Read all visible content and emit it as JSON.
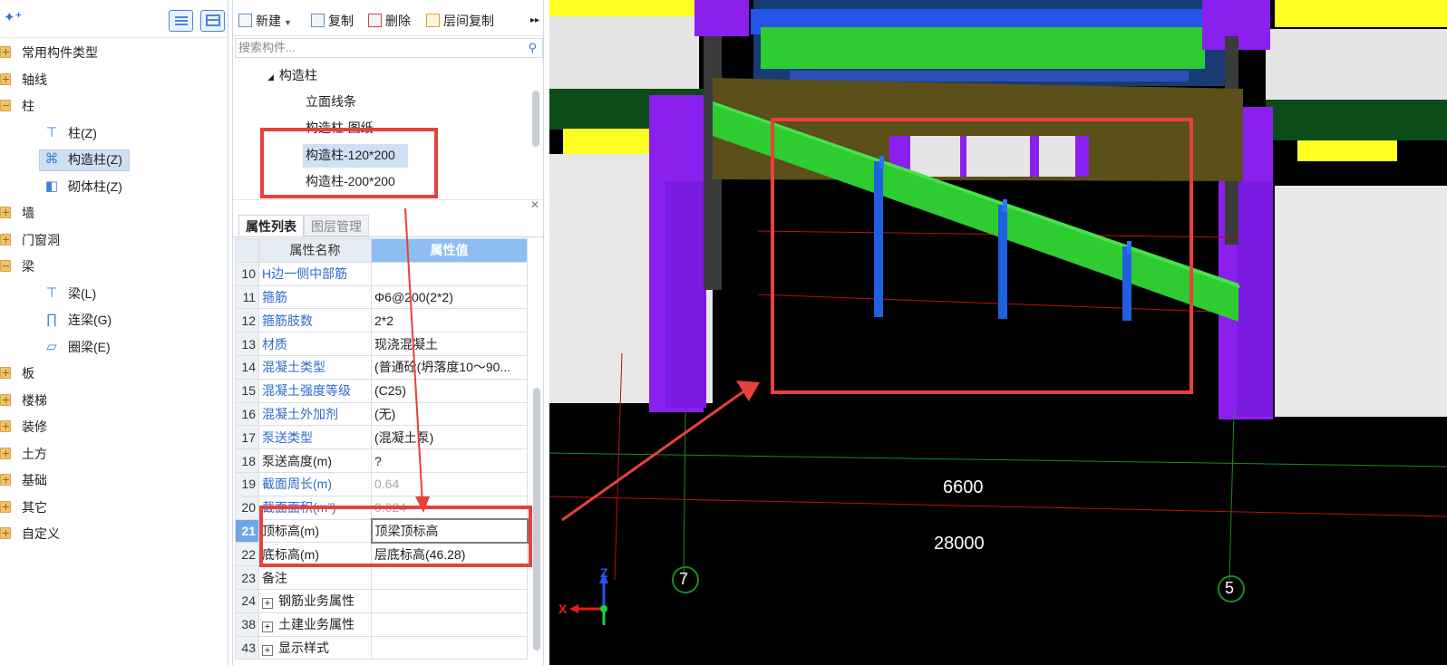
{
  "nav_tree": {
    "items": [
      {
        "label": "常用构件类型",
        "type": "folder",
        "open": false
      },
      {
        "label": "轴线",
        "type": "folder",
        "open": false
      },
      {
        "label": "柱",
        "type": "folder",
        "open": true
      },
      {
        "label": "柱(Z)",
        "type": "child",
        "icon": "column-icon"
      },
      {
        "label": "构造柱(Z)",
        "type": "child",
        "icon": "construction-column-icon",
        "selected": true
      },
      {
        "label": "砌体柱(Z)",
        "type": "child",
        "icon": "masonry-column-icon"
      },
      {
        "label": "墙",
        "type": "folder",
        "open": false
      },
      {
        "label": "门窗洞",
        "type": "folder",
        "open": false
      },
      {
        "label": "梁",
        "type": "folder",
        "open": true
      },
      {
        "label": "梁(L)",
        "type": "child",
        "icon": "beam-icon"
      },
      {
        "label": "连梁(G)",
        "type": "child",
        "icon": "link-beam-icon"
      },
      {
        "label": "圈梁(E)",
        "type": "child",
        "icon": "ring-beam-icon"
      },
      {
        "label": "板",
        "type": "folder",
        "open": false
      },
      {
        "label": "楼梯",
        "type": "folder",
        "open": false
      },
      {
        "label": "装修",
        "type": "folder",
        "open": false
      },
      {
        "label": "土方",
        "type": "folder",
        "open": false
      },
      {
        "label": "基础",
        "type": "folder",
        "open": false
      },
      {
        "label": "其它",
        "type": "folder",
        "open": false
      },
      {
        "label": "自定义",
        "type": "folder",
        "open": false
      }
    ]
  },
  "toolbar": {
    "new_label": "新建",
    "copy_label": "复制",
    "delete_label": "删除",
    "floor_copy_label": "层间复制",
    "more_label": "▸▸"
  },
  "search": {
    "placeholder": "搜索构件..."
  },
  "component_list": {
    "group": "构造柱",
    "items": [
      {
        "label": "立面线条"
      },
      {
        "label": "构造柱-图纸"
      },
      {
        "label": "构造柱-120*200",
        "selected": true
      },
      {
        "label": "构造柱-200*200"
      }
    ]
  },
  "property_panel": {
    "tabs": [
      "属性列表",
      "图层管理"
    ],
    "header": {
      "name": "属性名称",
      "value": "属性值"
    },
    "rows": [
      {
        "n": "10",
        "name": "H边一侧中部筋",
        "value": "",
        "blue": true
      },
      {
        "n": "11",
        "name": "箍筋",
        "value": "Φ6@200(2*2)",
        "blue": true
      },
      {
        "n": "12",
        "name": "箍筋肢数",
        "value": "2*2",
        "blue": true
      },
      {
        "n": "13",
        "name": "材质",
        "value": "现浇混凝土",
        "blue": true
      },
      {
        "n": "14",
        "name": "混凝土类型",
        "value": "(普通砼(坍落度10～90...",
        "blue": true
      },
      {
        "n": "15",
        "name": "混凝土强度等级",
        "value": "(C25)",
        "blue": true
      },
      {
        "n": "16",
        "name": "混凝土外加剂",
        "value": "(无)",
        "blue": true
      },
      {
        "n": "17",
        "name": "泵送类型",
        "value": "(混凝土泵)",
        "blue": true
      },
      {
        "n": "18",
        "name": "泵送高度(m)",
        "value": "?",
        "blue": false
      },
      {
        "n": "19",
        "name": "截面周长(m)",
        "value": "0.64",
        "blue": true,
        "gray": true
      },
      {
        "n": "20",
        "name": "截面面积(m²)",
        "value": "0.024",
        "blue": true,
        "gray": true
      },
      {
        "n": "21",
        "name": "顶标高(m)",
        "value": "顶梁顶标高",
        "blue": false,
        "active": true
      },
      {
        "n": "22",
        "name": "底标高(m)",
        "value": "层底标高(46.28)",
        "blue": false
      },
      {
        "n": "23",
        "name": "备注",
        "value": "",
        "blue": false
      },
      {
        "n": "24",
        "name": "钢筋业务属性",
        "value": "",
        "blue": false,
        "expand": true
      },
      {
        "n": "38",
        "name": "土建业务属性",
        "value": "",
        "blue": false,
        "expand": true
      },
      {
        "n": "43",
        "name": "显示样式",
        "value": "",
        "blue": false,
        "expand": true
      }
    ]
  },
  "viewport": {
    "dimension_1": "6600",
    "dimension_2": "28000",
    "grid_axis_left": "7",
    "grid_axis_right": "5",
    "axis_z": "Z",
    "axis_x": "X",
    "colors": {
      "beam_green": "#2ecc31",
      "column_purple": "#8a20ee",
      "post_blue": "#1f5fe0",
      "slab_olive": "#5b4f1a",
      "highlight_yellow": "#ffff22",
      "annotation_red": "#e7413c"
    }
  }
}
